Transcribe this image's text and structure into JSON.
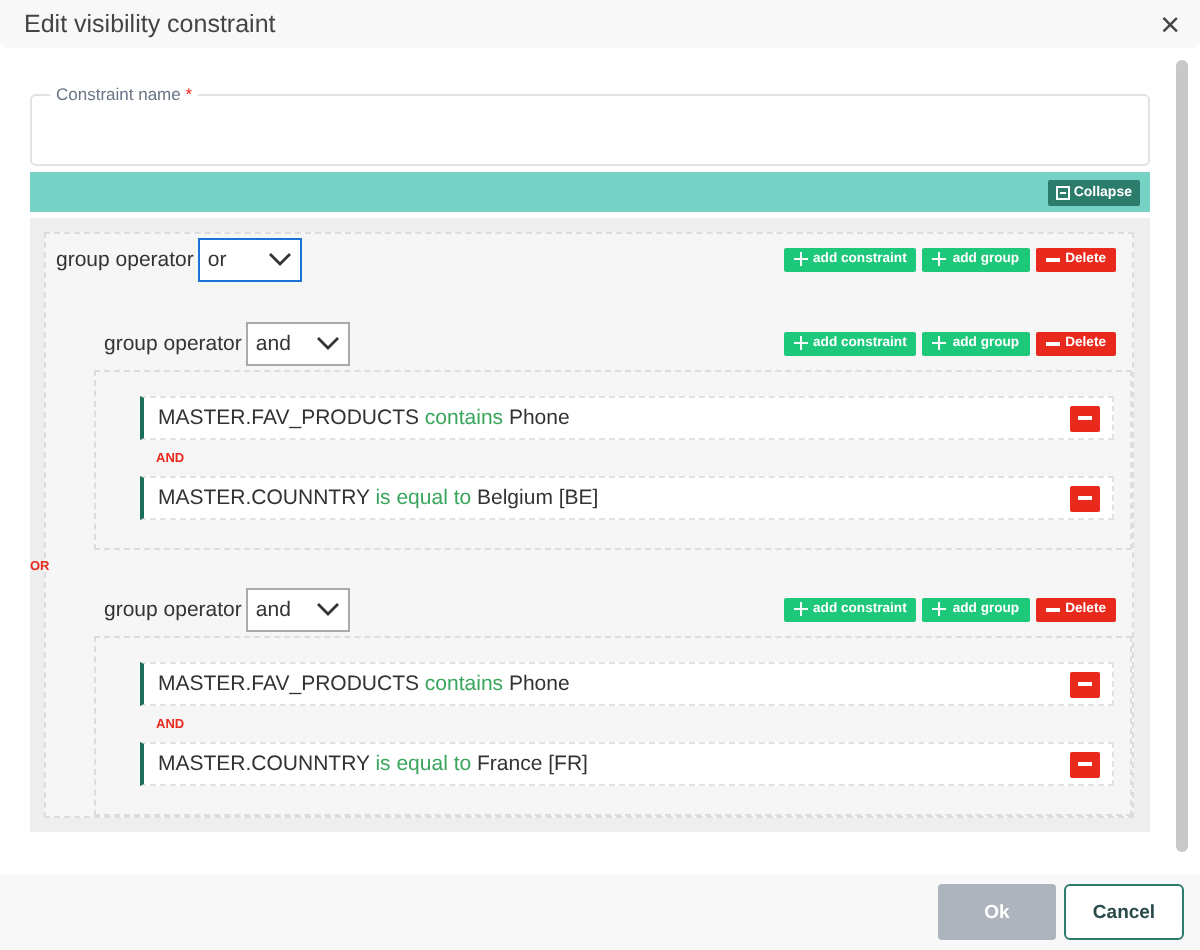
{
  "dialog": {
    "title": "Edit visibility constraint",
    "close": "×"
  },
  "name_field": {
    "label": "Constraint name",
    "required_mark": "*"
  },
  "collapse_button": "Collapse",
  "root_group": {
    "operator_label": "group operator",
    "operator": "or",
    "focused": true,
    "add_constraint": "add constraint",
    "add_group": "add group",
    "delete": "Delete",
    "separator": "OR",
    "children": [
      {
        "kind": "group",
        "operator_label": "group operator",
        "operator": "and",
        "focused": false,
        "add_constraint": "add constraint",
        "add_group": "add group",
        "delete": "Delete",
        "separator": "AND",
        "children": [
          {
            "kind": "constraint",
            "field": "MASTER.FAV_PRODUCTS",
            "operator": "contains",
            "value": "Phone"
          },
          {
            "kind": "constraint",
            "field": "MASTER.COUNNTRY",
            "operator": "is equal to",
            "value": "Belgium [BE]"
          }
        ]
      },
      {
        "kind": "group",
        "operator_label": "group operator",
        "operator": "and",
        "focused": false,
        "add_constraint": "add constraint",
        "add_group": "add group",
        "delete": "Delete",
        "separator": "AND",
        "children": [
          {
            "kind": "constraint",
            "field": "MASTER.FAV_PRODUCTS",
            "operator": "contains",
            "value": "Phone"
          },
          {
            "kind": "constraint",
            "field": "MASTER.COUNNTRY",
            "operator": "is equal to",
            "value": "France [FR]"
          }
        ]
      }
    ]
  },
  "footer": {
    "ok": "Ok",
    "ok_disabled": true,
    "cancel": "Cancel"
  }
}
